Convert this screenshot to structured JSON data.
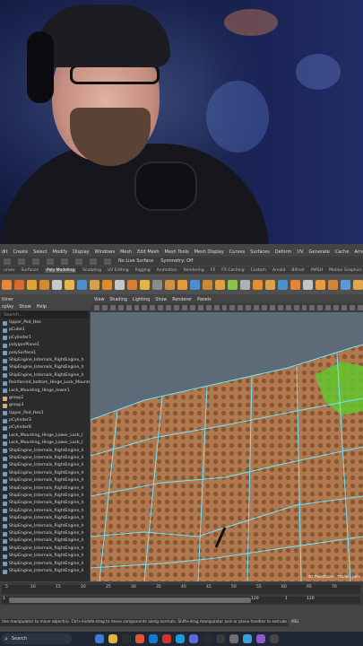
{
  "maya": {
    "menus": [
      "dit",
      "Create",
      "Select",
      "Modify",
      "Display",
      "Windows",
      "Mesh",
      "Edit Mesh",
      "Mesh Tools",
      "Mesh Display",
      "Curves",
      "Surfaces",
      "Deform",
      "UV",
      "Generate",
      "Cache",
      "Arnold",
      "Bonus Tools"
    ],
    "status": {
      "live_surface": "No Live Surface",
      "symmetry": "Symmetry: Off"
    },
    "shelf_tabs": [
      "urves",
      "Surfaces",
      "Poly Modeling",
      "Sculpting",
      "UV Editing",
      "Rigging",
      "Animation",
      "Rendering",
      "FX",
      "FX Caching",
      "Custom",
      "Arnold",
      "Bifrost",
      "MASH",
      "Motion Graphics"
    ],
    "active_shelf_tab": "Poly Modeling",
    "outliner": {
      "title": "tliner",
      "menu": [
        "splay",
        "Show",
        "Help"
      ],
      "search_placeholder": "Search...",
      "items": [
        "Upper_Pod_Hex",
        "pCube1",
        "pCylinder1",
        "polygonPlane1",
        "polySurface1",
        "ShipEngine_Internals_RightEngine_h",
        "ShipEngine_Internals_RightEngine_h",
        "ShipEngine_Internals_RightEngine_h",
        "Reinforced_bottom_Hinge_Lock_Mounts",
        "Lock_Mounting_Hinge_lower1",
        "group2",
        "group3",
        "Upper_Pod_Hex1",
        "pCylinder3",
        "pCylinder8",
        "Lock_Mounting_Hinge_Lower_Lock_I",
        "Lock_Mounting_Hinge_Lower_Lock_I",
        "ShipEngine_Internals_RightEngine_h",
        "ShipEngine_Internals_RightEngine_h",
        "ShipEngine_Internals_RightEngine_h",
        "ShipEngine_Internals_RightEngine_h",
        "ShipEngine_Internals_RightEngine_h",
        "ShipEngine_Internals_RightEngine_h",
        "ShipEngine_Internals_RightEngine_h",
        "ShipEngine_Internals_RightEngine_h",
        "ShipEngine_Internals_RightEngine_h",
        "ShipEngine_Internals_RightEngine_h",
        "ShipEngine_Internals_RightEngine_h",
        "ShipEngine_Internals_RightEngine_h",
        "ShipEngine_Internals_RightEngine_h",
        "ShipEngine_Internals_RightEngine_h",
        "ShipEngine_Internals_RightEngine_h",
        "ShipEngine_Internals_RightEngine_h",
        "ShipEngine_Internals_RightEngine_h"
      ]
    },
    "viewport": {
      "menu": [
        "View",
        "Shading",
        "Lighting",
        "Show",
        "Renderer",
        "Panels"
      ],
      "label": "3D PaintZoom : Tnalite : pers"
    },
    "timeline": {
      "ticks": [
        "5",
        "10",
        "15",
        "20",
        "25",
        "30",
        "35",
        "40",
        "45",
        "50",
        "55",
        "60",
        "65",
        "70"
      ],
      "range_start": "1",
      "range_end": "120",
      "range_start_right": "1",
      "range_end_right": "120"
    },
    "help_line": "Use manipulator to move object(s). Ctrl+middle-drag to move components along normals. Shift+drag manipulator axis or plane handles to extrude components or clone objects.",
    "mel_label": "MEL"
  },
  "taskbar": {
    "search_label": "Search",
    "app_colors": [
      "#3d7bd8",
      "#e5b53b",
      "#2f2f2f",
      "#e4532f",
      "#1b75d2",
      "#d0312d",
      "#1a9ad6",
      "#5c6ad9",
      "#2a2a2a",
      "#3a3a3a",
      "#6f6f6f",
      "#3aa0d8",
      "#8c5ad0",
      "#444444"
    ]
  },
  "colors": {
    "viewport_bg": "#5d6a77",
    "face_fill": "#b07950",
    "dot": "#8a5631",
    "wire": "#6fe6ff",
    "selected_face": "#63c72e"
  }
}
